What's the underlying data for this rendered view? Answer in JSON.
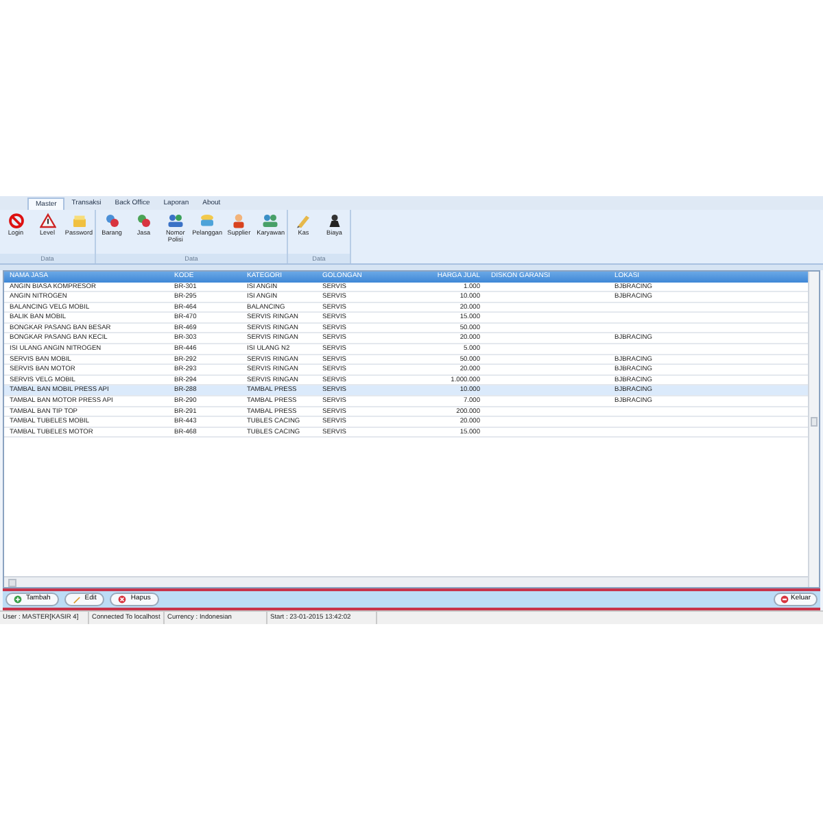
{
  "tabs": [
    {
      "label": "Master",
      "selected": true
    },
    {
      "label": "Transaksi",
      "selected": false
    },
    {
      "label": "Back Office",
      "selected": false
    },
    {
      "label": "Laporan",
      "selected": false
    },
    {
      "label": "About",
      "selected": false
    }
  ],
  "ribbon": [
    {
      "title": "Data",
      "items": [
        "Login",
        "Level",
        "Password"
      ]
    },
    {
      "title": "Data",
      "items": [
        "Barang",
        "Jasa",
        "Nomor Polisi",
        "Pelanggan",
        "Supplier",
        "Karyawan"
      ]
    },
    {
      "title": "Data",
      "items": [
        "Kas",
        "Biaya"
      ]
    }
  ],
  "table": {
    "columns": [
      "NAMA JASA",
      "KODE",
      "KATEGORI",
      "GOLONGAN",
      "HARGA JUAL",
      "DISKON GARANSI",
      "LOKASI"
    ],
    "rows": [
      {
        "cells": [
          "ANGIN BIASA KOMPRESOR",
          "BR-301",
          "ISI ANGIN",
          "SERVIS",
          "1.000",
          "",
          "BJBRACING"
        ],
        "selected": false
      },
      {
        "cells": [
          "ANGIN NITROGEN",
          "BR-295",
          "ISI ANGIN",
          "SERVIS",
          "10.000",
          "",
          "BJBRACING"
        ],
        "selected": false
      },
      {
        "cells": [
          "BALANCING VELG MOBIL",
          "BR-464",
          "BALANCING",
          "SERVIS",
          "20.000",
          "",
          ""
        ],
        "selected": false
      },
      {
        "cells": [
          "BALIK BAN MOBIL",
          "BR-470",
          "SERVIS RINGAN",
          "SERVIS",
          "15.000",
          "",
          ""
        ],
        "selected": false
      },
      {
        "cells": [
          "BONGKAR PASANG BAN BESAR",
          "BR-469",
          "SERVIS RINGAN",
          "SERVIS",
          "50.000",
          "",
          ""
        ],
        "selected": false
      },
      {
        "cells": [
          "BONGKAR PASANG BAN KECIL",
          "BR-303",
          "SERVIS RINGAN",
          "SERVIS",
          "20.000",
          "",
          "BJBRACING"
        ],
        "selected": false
      },
      {
        "cells": [
          "ISI ULANG ANGIN NITROGEN",
          "BR-446",
          "ISI ULANG  N2",
          "SERVIS",
          "5.000",
          "",
          ""
        ],
        "selected": false
      },
      {
        "cells": [
          "SERVIS BAN MOBIL",
          "BR-292",
          "SERVIS RINGAN",
          "SERVIS",
          "50.000",
          "",
          "BJBRACING"
        ],
        "selected": false
      },
      {
        "cells": [
          "SERVIS BAN MOTOR",
          "BR-293",
          "SERVIS RINGAN",
          "SERVIS",
          "20.000",
          "",
          "BJBRACING"
        ],
        "selected": false
      },
      {
        "cells": [
          "SERVIS VELG MOBIL",
          "BR-294",
          "SERVIS RINGAN",
          "SERVIS",
          "1.000.000",
          "",
          "BJBRACING"
        ],
        "selected": false
      },
      {
        "cells": [
          "TAMBAL BAN MOBIL PRESS API",
          "BR-288",
          "TAMBAL PRESS",
          "SERVIS",
          "10.000",
          "",
          "BJBRACING"
        ],
        "selected": true
      },
      {
        "cells": [
          "TAMBAL BAN MOTOR PRESS API",
          "BR-290",
          "TAMBAL PRESS",
          "SERVIS",
          "7.000",
          "",
          "BJBRACING"
        ],
        "selected": false
      },
      {
        "cells": [
          "TAMBAL BAN TIP TOP",
          "BR-291",
          "TAMBAL PRESS",
          "SERVIS",
          "200.000",
          "",
          ""
        ],
        "selected": false
      },
      {
        "cells": [
          "TAMBAL TUBELES MOBIL",
          "BR-443",
          "TUBLES CACING",
          "SERVIS",
          "20.000",
          "",
          ""
        ],
        "selected": false
      },
      {
        "cells": [
          "TAMBAL TUBELES MOTOR",
          "BR-468",
          "TUBLES CACING",
          "SERVIS",
          "15.000",
          "",
          ""
        ],
        "selected": false
      }
    ]
  },
  "buttons": [
    {
      "label": "Tambah",
      "kind": "add"
    },
    {
      "label": "Edit",
      "kind": "edit"
    },
    {
      "label": "Hapus",
      "kind": "delete"
    }
  ],
  "exit_button": {
    "label": "Keluar"
  },
  "status_bar": [
    "User : MASTER[KASIR 4]",
    "Connected To localhost",
    "Currency : Indonesian",
    "Start : 23-01-2015 13:42:02"
  ]
}
